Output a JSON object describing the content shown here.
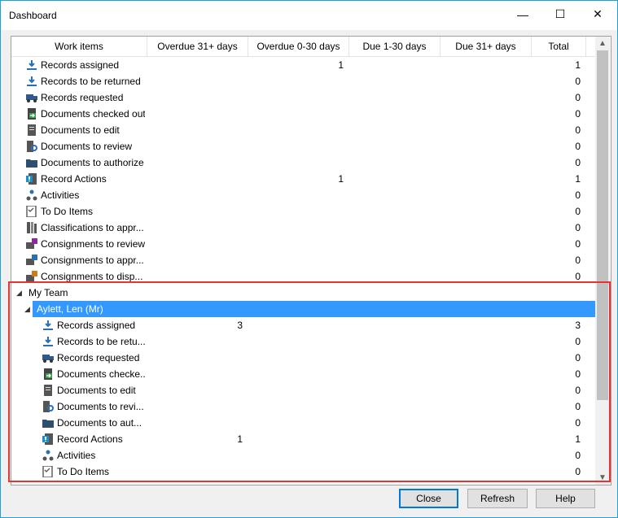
{
  "window": {
    "title": "Dashboard",
    "minimize": "—",
    "maximize": "☐",
    "close": "✕"
  },
  "columns": [
    "Work items",
    "Overdue 31+ days",
    "Overdue 0-30 days",
    "Due 1-30 days",
    "Due 31+ days",
    "Total"
  ],
  "items": [
    {
      "label": "Records assigned",
      "icon": "download-arrow-icon",
      "od0_30": "1",
      "total": "1"
    },
    {
      "label": "Records to be returned",
      "icon": "download-arrow-icon",
      "total": "0"
    },
    {
      "label": "Records requested",
      "icon": "truck-icon",
      "total": "0"
    },
    {
      "label": "Documents checked out",
      "icon": "document-checkout-icon",
      "total": "0"
    },
    {
      "label": "Documents to edit",
      "icon": "document-edit-icon",
      "total": "0"
    },
    {
      "label": "Documents to review",
      "icon": "document-review-icon",
      "total": "0"
    },
    {
      "label": "Documents to authorize",
      "icon": "folder-icon",
      "total": "0"
    },
    {
      "label": "Record Actions",
      "icon": "record-action-icon",
      "od0_30": "1",
      "total": "1"
    },
    {
      "label": "Activities",
      "icon": "activities-icon",
      "total": "0"
    },
    {
      "label": "To Do Items",
      "icon": "todo-icon",
      "total": "0"
    },
    {
      "label": "Classifications to appr...",
      "icon": "classification-icon",
      "total": "0"
    },
    {
      "label": "Consignments to review",
      "icon": "consignment-icon",
      "total": "0"
    },
    {
      "label": "Consignments to appr...",
      "icon": "consignment-approve-icon",
      "total": "0"
    },
    {
      "label": "Consignments to disp...",
      "icon": "consignment-dispose-icon",
      "total": "0"
    }
  ],
  "team": {
    "label": "My Team",
    "member": "Aylett, Len (Mr)",
    "items": [
      {
        "label": "Records assigned",
        "icon": "download-arrow-icon",
        "od31": "3",
        "total": "3"
      },
      {
        "label": "Records to be retu...",
        "icon": "download-arrow-icon",
        "total": "0"
      },
      {
        "label": "Records requested",
        "icon": "truck-icon",
        "total": "0"
      },
      {
        "label": "Documents checke...",
        "icon": "document-checkout-icon",
        "total": "0"
      },
      {
        "label": "Documents to edit",
        "icon": "document-edit-icon",
        "total": "0"
      },
      {
        "label": "Documents to revi...",
        "icon": "document-review-icon",
        "total": "0"
      },
      {
        "label": "Documents to aut...",
        "icon": "folder-icon",
        "total": "0"
      },
      {
        "label": "Record Actions",
        "icon": "record-action-icon",
        "od31": "1",
        "total": "1"
      },
      {
        "label": "Activities",
        "icon": "activities-icon",
        "total": "0"
      },
      {
        "label": "To Do Items",
        "icon": "todo-icon",
        "total": "0"
      }
    ]
  },
  "buttons": {
    "close": "Close",
    "refresh": "Refresh",
    "help": "Help"
  },
  "colors": {
    "selection": "#3399ff",
    "highlight_border": "#e63333",
    "window_border": "#1f9fd8"
  }
}
